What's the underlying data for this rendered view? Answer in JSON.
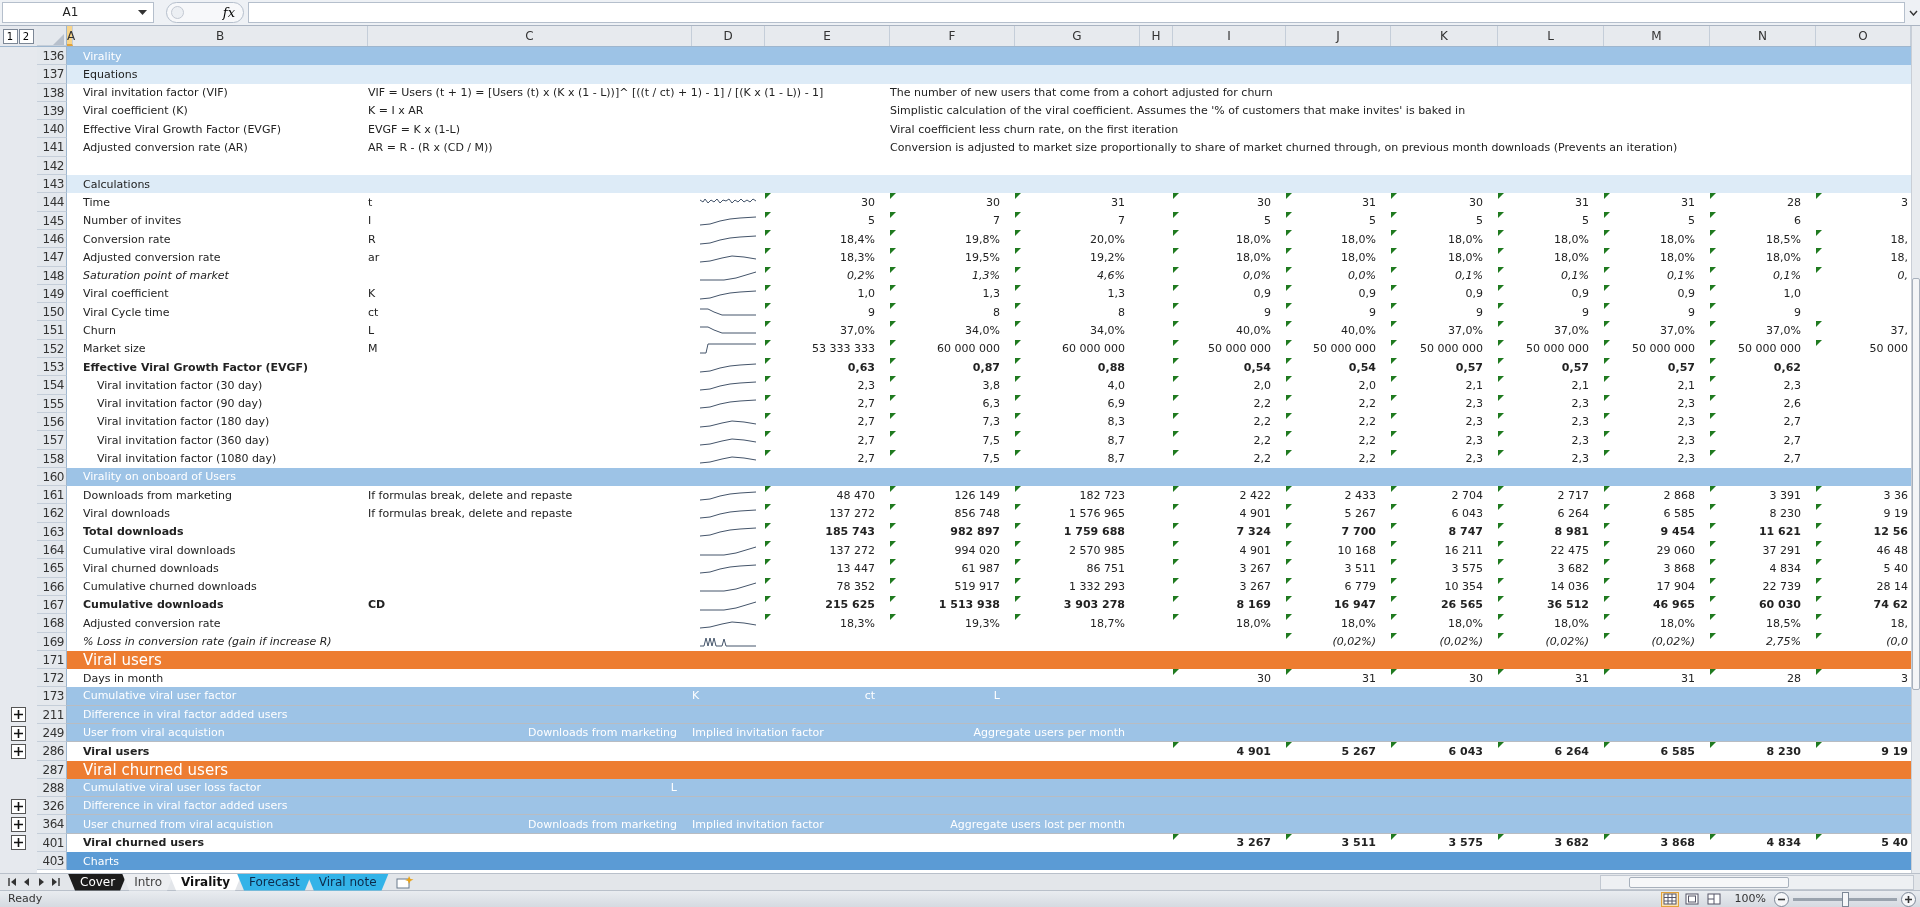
{
  "formula_bar": {
    "cell_ref": "A1",
    "function_button": "fx"
  },
  "outline_levels": [
    {
      "label": "1"
    },
    {
      "label": "2"
    }
  ],
  "columns": [
    {
      "label": "A",
      "selected": true
    },
    {
      "label": "B",
      "selected": false
    },
    {
      "label": "C",
      "selected": false
    },
    {
      "label": "D",
      "selected": false
    },
    {
      "label": "E",
      "selected": false
    },
    {
      "label": "F",
      "selected": false
    },
    {
      "label": "G",
      "selected": false
    },
    {
      "label": "H",
      "selected": false
    },
    {
      "label": "I",
      "selected": false
    },
    {
      "label": "J",
      "selected": false
    },
    {
      "label": "K",
      "selected": false
    },
    {
      "label": "L",
      "selected": false
    },
    {
      "label": "M",
      "selected": false
    },
    {
      "label": "N",
      "selected": false
    },
    {
      "label": "O",
      "selected": false
    }
  ],
  "rows": [
    {
      "number": "136",
      "kind": "section",
      "label": "Virality"
    },
    {
      "number": "137",
      "kind": "subsection",
      "label": "Equations"
    },
    {
      "number": "138",
      "kind": "equation",
      "label": "Viral invitation factor (VIF)",
      "cells": [
        "VIF = Users (t + 1) = [Users  (t) x (K x (1 - L))]^ [((t / ct) + 1) - 1] / [(K x (1 - L)) - 1]",
        null,
        null,
        "The number of new users that come from a cohort adjusted for churn"
      ]
    },
    {
      "number": "139",
      "kind": "equation",
      "label": "Viral coefficient (K)",
      "cells": [
        "K = I x AR",
        null,
        null,
        "Simplistic calculation of the viral coefficient. Assumes the '% of customers that make invites' is baked in"
      ]
    },
    {
      "number": "140",
      "kind": "equation",
      "label": "Effective Viral Growth Factor (EVGF)",
      "cells": [
        "EVGF = K x (1-L)",
        null,
        null,
        "Viral coefficient less churn rate, on the first iteration"
      ]
    },
    {
      "number": "141",
      "kind": "equation",
      "label": "Adjusted conversion rate (AR)",
      "cells": [
        "AR = R - (R x (CD / M))",
        null,
        null,
        "Conversion is adjusted to market size proportionally to share of market churned through, on previous month downloads (Prevents an iteration)"
      ]
    },
    {
      "number": "142",
      "kind": "blank"
    },
    {
      "number": "143",
      "kind": "subsection",
      "label": "Calculations"
    },
    {
      "number": "144",
      "kind": "data",
      "label": "Time",
      "sparkline": true,
      "flagged": true,
      "cells": [
        "t",
        null,
        "30",
        "30",
        "31",
        null,
        "30",
        "31",
        "30",
        "31",
        "31",
        "28",
        "3"
      ]
    },
    {
      "number": "145",
      "kind": "data",
      "label": "Number of invites",
      "sparkline": true,
      "flagged": true,
      "cells": [
        "I",
        null,
        "5",
        "7",
        "7",
        null,
        "5",
        "5",
        "5",
        "5",
        "5",
        "6",
        null
      ]
    },
    {
      "number": "146",
      "kind": "data",
      "label": "Conversion rate",
      "sparkline": true,
      "flagged": true,
      "cells": [
        "R",
        null,
        "18,4%",
        "19,8%",
        "20,0%",
        null,
        "18,0%",
        "18,0%",
        "18,0%",
        "18,0%",
        "18,0%",
        "18,5%",
        "18,"
      ]
    },
    {
      "number": "147",
      "kind": "data",
      "label": "Adjusted conversion rate",
      "sparkline": true,
      "flagged": true,
      "cells": [
        "ar",
        null,
        "18,3%",
        "19,5%",
        "19,2%",
        null,
        "18,0%",
        "18,0%",
        "18,0%",
        "18,0%",
        "18,0%",
        "18,0%",
        "18,"
      ]
    },
    {
      "number": "148",
      "kind": "aside",
      "label": "Saturation point of market",
      "sparkline": true,
      "flagged": true,
      "cells": [
        null,
        null,
        "0,2%",
        "1,3%",
        "4,6%",
        null,
        "0,0%",
        "0,0%",
        "0,1%",
        "0,1%",
        "0,1%",
        "0,1%",
        "0,"
      ]
    },
    {
      "number": "149",
      "kind": "data",
      "label": "Viral coefficient",
      "sparkline": true,
      "flagged": true,
      "cells": [
        "K",
        null,
        "1,0",
        "1,3",
        "1,3",
        null,
        "0,9",
        "0,9",
        "0,9",
        "0,9",
        "0,9",
        "1,0",
        null
      ]
    },
    {
      "number": "150",
      "kind": "data",
      "label": "Viral Cycle time",
      "sparkline": true,
      "flagged": true,
      "cells": [
        "ct",
        null,
        "9",
        "8",
        "8",
        null,
        "9",
        "9",
        "9",
        "9",
        "9",
        "9",
        null
      ]
    },
    {
      "number": "151",
      "kind": "data",
      "label": "Churn",
      "sparkline": true,
      "flagged": true,
      "cells": [
        "L",
        null,
        "37,0%",
        "34,0%",
        "34,0%",
        null,
        "40,0%",
        "40,0%",
        "37,0%",
        "37,0%",
        "37,0%",
        "37,0%",
        "37,"
      ]
    },
    {
      "number": "152",
      "kind": "data",
      "label": "Market size",
      "sparkline": true,
      "flagged": true,
      "cells": [
        "M",
        null,
        "53 333 333",
        "60 000 000",
        "60 000 000",
        null,
        "50 000 000",
        "50 000 000",
        "50 000 000",
        "50 000 000",
        "50 000 000",
        "50 000 000",
        "50 000"
      ]
    },
    {
      "number": "153",
      "kind": "total",
      "label": "Effective Viral Growth Factor (EVGF)",
      "sparkline": true,
      "flagged": true,
      "cells": [
        null,
        null,
        "0,63",
        "0,87",
        "0,88",
        null,
        "0,54",
        "0,54",
        "0,57",
        "0,57",
        "0,57",
        "0,62",
        null
      ],
      "children": [
        {
          "number": "154",
          "kind": "data",
          "label": "Viral invitation factor (30 day)",
          "sparkline": true,
          "flagged": true,
          "cells": [
            null,
            null,
            "2,3",
            "3,8",
            "4,0",
            null,
            "2,0",
            "2,0",
            "2,1",
            "2,1",
            "2,1",
            "2,3",
            null
          ]
        },
        {
          "number": "155",
          "kind": "data",
          "label": "Viral invitation factor (90 day)",
          "sparkline": true,
          "flagged": true,
          "cells": [
            null,
            null,
            "2,7",
            "6,3",
            "6,9",
            null,
            "2,2",
            "2,2",
            "2,3",
            "2,3",
            "2,3",
            "2,6",
            null
          ]
        },
        {
          "number": "156",
          "kind": "data",
          "label": "Viral invitation factor (180 day)",
          "sparkline": true,
          "flagged": true,
          "cells": [
            null,
            null,
            "2,7",
            "7,3",
            "8,3",
            null,
            "2,2",
            "2,2",
            "2,3",
            "2,3",
            "2,3",
            "2,7",
            null
          ]
        },
        {
          "number": "157",
          "kind": "data",
          "label": "Viral invitation factor (360 day)",
          "sparkline": true,
          "flagged": true,
          "cells": [
            null,
            null,
            "2,7",
            "7,5",
            "8,7",
            null,
            "2,2",
            "2,2",
            "2,3",
            "2,3",
            "2,3",
            "2,7",
            null
          ]
        },
        {
          "number": "158",
          "kind": "data",
          "label": "Viral invitation factor (1080 day)",
          "sparkline": true,
          "flagged": true,
          "cells": [
            null,
            null,
            "2,7",
            "7,5",
            "8,7",
            null,
            "2,2",
            "2,2",
            "2,3",
            "2,3",
            "2,3",
            "2,7",
            null
          ]
        }
      ]
    },
    {
      "number": "160",
      "kind": "section",
      "label": "Virality on onboard of Users"
    },
    {
      "number": "161",
      "kind": "data",
      "label": "Downloads from marketing",
      "sparkline": true,
      "flagged": true,
      "cells": [
        "If formulas break, delete and repaste",
        null,
        "48 470",
        "126 149",
        "182 723",
        null,
        "2 422",
        "2 433",
        "2 704",
        "2 717",
        "2 868",
        "3 391",
        "3 36"
      ]
    },
    {
      "number": "162",
      "kind": "data",
      "label": "Viral downloads",
      "sparkline": true,
      "flagged": true,
      "cells": [
        "If formulas break, delete and repaste",
        null,
        "137 272",
        "856 748",
        "1 576 965",
        null,
        "4 901",
        "5 267",
        "6 043",
        "6 264",
        "6 585",
        "8 230",
        "9 19"
      ]
    },
    {
      "number": "163",
      "kind": "total",
      "label": "Total downloads",
      "sparkline": true,
      "flagged": true,
      "cells": [
        null,
        null,
        "185 743",
        "982 897",
        "1 759 688",
        null,
        "7 324",
        "7 700",
        "8 747",
        "8 981",
        "9 454",
        "11 621",
        "12 56"
      ]
    },
    {
      "number": "164",
      "kind": "data",
      "label": "Cumulative viral downloads",
      "sparkline": true,
      "flagged": true,
      "cells": [
        null,
        null,
        "137 272",
        "994 020",
        "2 570 985",
        null,
        "4 901",
        "10 168",
        "16 211",
        "22 475",
        "29 060",
        "37 291",
        "46 48"
      ]
    },
    {
      "number": "165",
      "kind": "data",
      "label": "Viral churned downloads",
      "sparkline": true,
      "flagged": true,
      "cells": [
        null,
        null,
        "13 447",
        "61 987",
        "86 751",
        null,
        "3 267",
        "3 511",
        "3 575",
        "3 682",
        "3 868",
        "4 834",
        "5 40"
      ]
    },
    {
      "number": "166",
      "kind": "data",
      "label": "Cumulative churned downloads",
      "sparkline": true,
      "flagged": true,
      "cells": [
        null,
        null,
        "78 352",
        "519 917",
        "1 332 293",
        null,
        "3 267",
        "6 779",
        "10 354",
        "14 036",
        "17 904",
        "22 739",
        "28 14"
      ]
    },
    {
      "number": "167",
      "kind": "total",
      "label": "Cumulative downloads",
      "sparkline": true,
      "flagged": true,
      "cells": [
        "CD",
        null,
        "215 625",
        "1 513 938",
        "3 903 278",
        null,
        "8 169",
        "16 947",
        "26 565",
        "36 512",
        "46 965",
        "60 030",
        "74 62"
      ]
    },
    {
      "number": "168",
      "kind": "data",
      "label": "Adjusted conversion rate",
      "sparkline": true,
      "flagged": true,
      "cells": [
        null,
        null,
        "18,3%",
        "19,3%",
        "18,7%",
        null,
        "18,0%",
        "18,0%",
        "18,0%",
        "18,0%",
        "18,0%",
        "18,5%",
        "18,"
      ]
    },
    {
      "number": "169",
      "kind": "aside",
      "label": "% Loss in conversion rate (gain if increase R)",
      "sparkline": true,
      "flagged": true,
      "cells": [
        null,
        null,
        null,
        null,
        null,
        null,
        null,
        "(0,02%)",
        "(0,02%)",
        "(0,02%)",
        "(0,02%)",
        "2,75%",
        "(0,0"
      ]
    },
    {
      "number": "171",
      "kind": "title",
      "label": "Viral users"
    },
    {
      "number": "172",
      "kind": "data",
      "label": "Days in month",
      "flagged": true,
      "cells": [
        null,
        null,
        null,
        null,
        null,
        null,
        "30",
        "31",
        "30",
        "31",
        "31",
        "28",
        "3"
      ]
    },
    {
      "number": "173",
      "kind": "group",
      "label": "Cumulative viral user factor",
      "cells": [
        null,
        "K",
        "ct",
        "L"
      ]
    },
    {
      "number": "211",
      "kind": "group",
      "label": "Difference in viral factor added users",
      "collapsed": true
    },
    {
      "number": "249",
      "kind": "group",
      "label": "User from viral acquistion",
      "collapsed": true,
      "cells": [
        "Downloads from marketing",
        "Implied invitation factor",
        null,
        null,
        "Aggregate users per month"
      ]
    },
    {
      "number": "286",
      "kind": "total",
      "label": "Viral users",
      "collapsed": true,
      "flagged": true,
      "cells": [
        null,
        null,
        null,
        null,
        null,
        null,
        "4 901",
        "5 267",
        "6 043",
        "6 264",
        "6 585",
        "8 230",
        "9 19"
      ]
    },
    {
      "number": "287",
      "kind": "title",
      "label": "Viral churned users"
    },
    {
      "number": "288",
      "kind": "group",
      "label": "Cumulative viral user loss factor",
      "cells": [
        "L"
      ]
    },
    {
      "number": "326",
      "kind": "group",
      "label": "Difference in viral factor added users",
      "collapsed": true
    },
    {
      "number": "364",
      "kind": "group",
      "label": "User churned from viral acquistion",
      "collapsed": true,
      "cells": [
        "Downloads from marketing",
        "Implied invitation factor",
        null,
        null,
        "Aggregate users lost per month"
      ]
    },
    {
      "number": "401",
      "kind": "total",
      "label": "Viral churned users",
      "collapsed": true,
      "flagged": true,
      "cells": [
        null,
        null,
        null,
        null,
        null,
        null,
        "3 267",
        "3 511",
        "3 575",
        "3 682",
        "3 868",
        "4 834",
        "5 40"
      ]
    },
    {
      "number": "403",
      "kind": "banner",
      "label": "Charts"
    }
  ],
  "sheet_tabs": [
    {
      "label": "Cover",
      "selected": false,
      "color": "#1c1c1c"
    },
    {
      "label": "Intro",
      "selected": false
    },
    {
      "label": "Virality",
      "selected": true
    },
    {
      "label": "Forecast",
      "selected": false,
      "color": "#33b3e8"
    },
    {
      "label": "Viral note",
      "selected": false,
      "color": "#33b3e8"
    }
  ],
  "status_bar": {
    "status": "Ready",
    "views": [
      {
        "kind": "normal",
        "selected": true
      },
      {
        "kind": "page-layout",
        "selected": false
      },
      {
        "kind": "page-break",
        "selected": false
      }
    ],
    "zoom": "100%",
    "zoom_slider": {
      "level": 0.5
    }
  }
}
